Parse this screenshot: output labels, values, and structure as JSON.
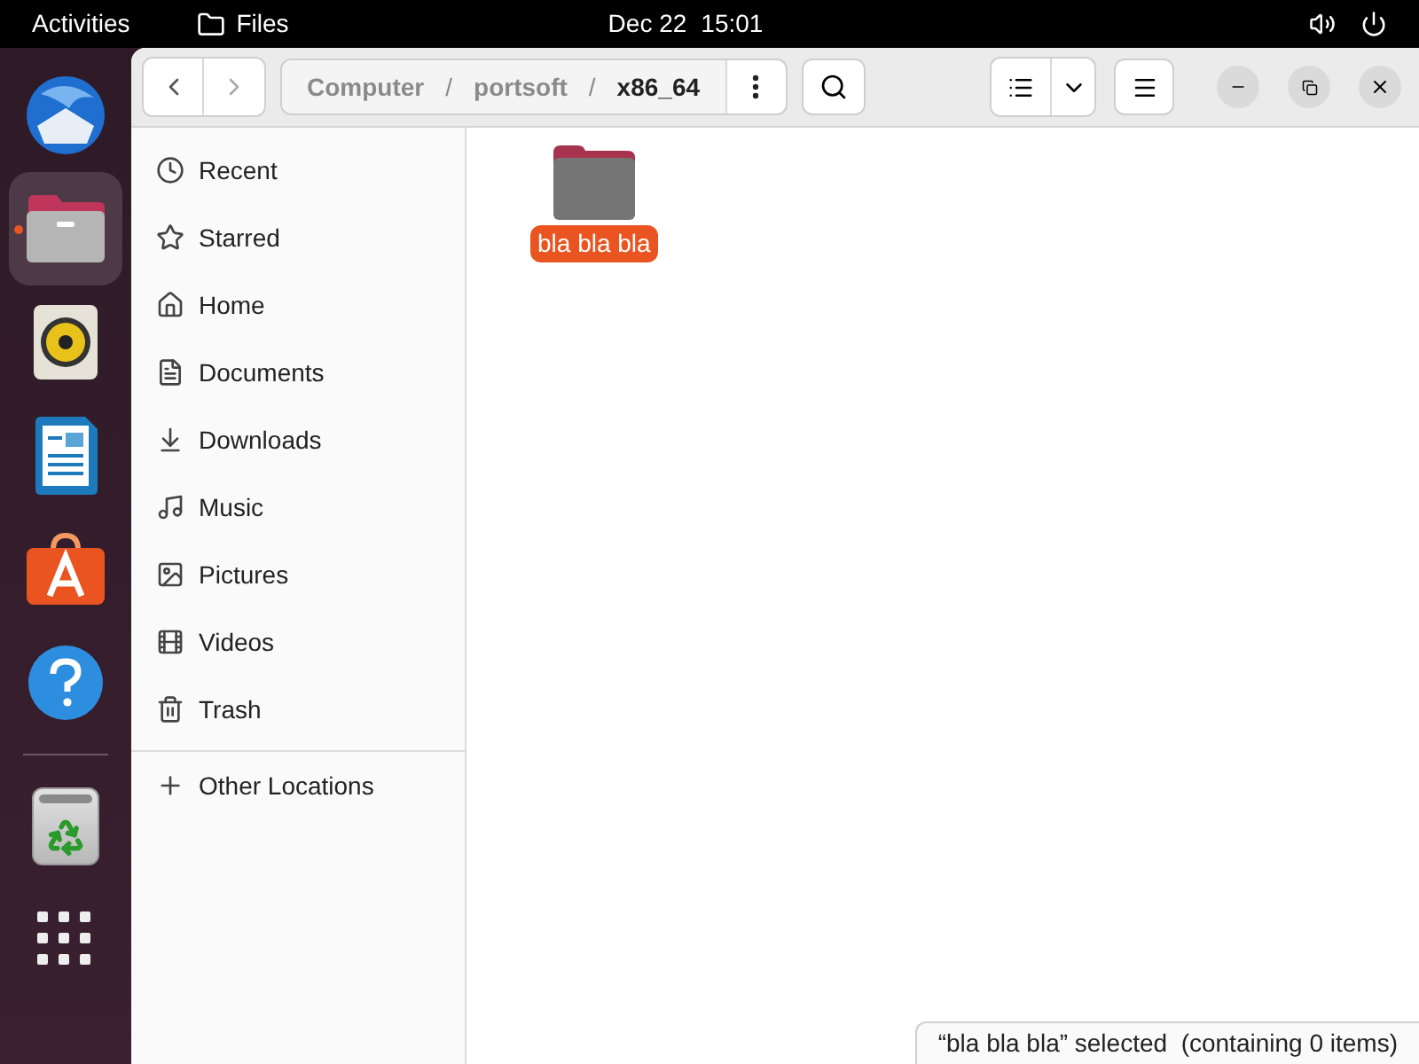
{
  "top_bar": {
    "activities": "Activities",
    "app_name": "Files",
    "date": "Dec 22",
    "time": "15:01"
  },
  "dock": {
    "apps": [
      {
        "kind": "mail",
        "selected": false
      },
      {
        "kind": "files",
        "selected": true
      },
      {
        "kind": "music-player",
        "selected": false
      },
      {
        "kind": "writer",
        "selected": false
      },
      {
        "kind": "store",
        "selected": false
      },
      {
        "kind": "help",
        "selected": false
      }
    ],
    "pinned": [
      {
        "kind": "trash",
        "selected": false
      },
      {
        "kind": "app-grid",
        "selected": false
      }
    ]
  },
  "breadcrumb": [
    {
      "label": "Computer",
      "selected": false
    },
    {
      "label": "portsoft",
      "selected": false
    },
    {
      "label": "x86_64",
      "selected": true
    }
  ],
  "breadcrumb_separator": "/",
  "sidebar": {
    "items": [
      {
        "kind": "recent",
        "label": "Recent"
      },
      {
        "kind": "starred",
        "label": "Starred"
      },
      {
        "kind": "home",
        "label": "Home"
      },
      {
        "kind": "documents",
        "label": "Documents"
      },
      {
        "kind": "downloads",
        "label": "Downloads"
      },
      {
        "kind": "music",
        "label": "Music"
      },
      {
        "kind": "pictures",
        "label": "Pictures"
      },
      {
        "kind": "videos",
        "label": "Videos"
      },
      {
        "kind": "trash",
        "label": "Trash"
      }
    ],
    "other": {
      "label": "Other Locations"
    }
  },
  "files": [
    {
      "name": "bla bla bla",
      "selected": true
    }
  ],
  "status": "“bla bla bla” selected  (containing 0 items)"
}
